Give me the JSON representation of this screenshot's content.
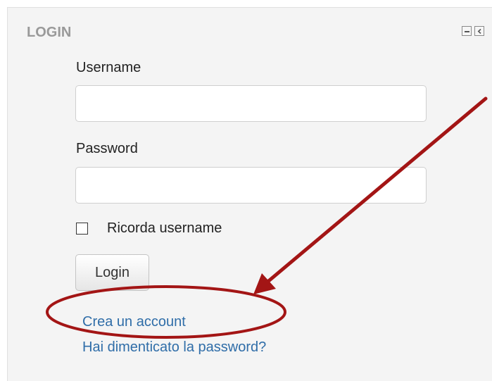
{
  "login_block": {
    "title": "LOGIN",
    "controls": {
      "collapse_icon": "minus-box-icon",
      "dock_icon": "chevron-left-box-icon"
    },
    "username": {
      "label": "Username",
      "value": "",
      "placeholder": ""
    },
    "password": {
      "label": "Password",
      "value": "",
      "placeholder": ""
    },
    "remember": {
      "label": "Ricorda username",
      "checked": false
    },
    "submit_label": "Login",
    "links": {
      "create_account": "Crea un account",
      "forgot_password": "Hai dimenticato la password?"
    }
  },
  "annotation": {
    "arrow_color": "#a31515",
    "ellipse_color": "#a31515"
  },
  "colors": {
    "link": "#2f6da8",
    "title": "#999999",
    "panel_background": "#f4f4f4"
  }
}
